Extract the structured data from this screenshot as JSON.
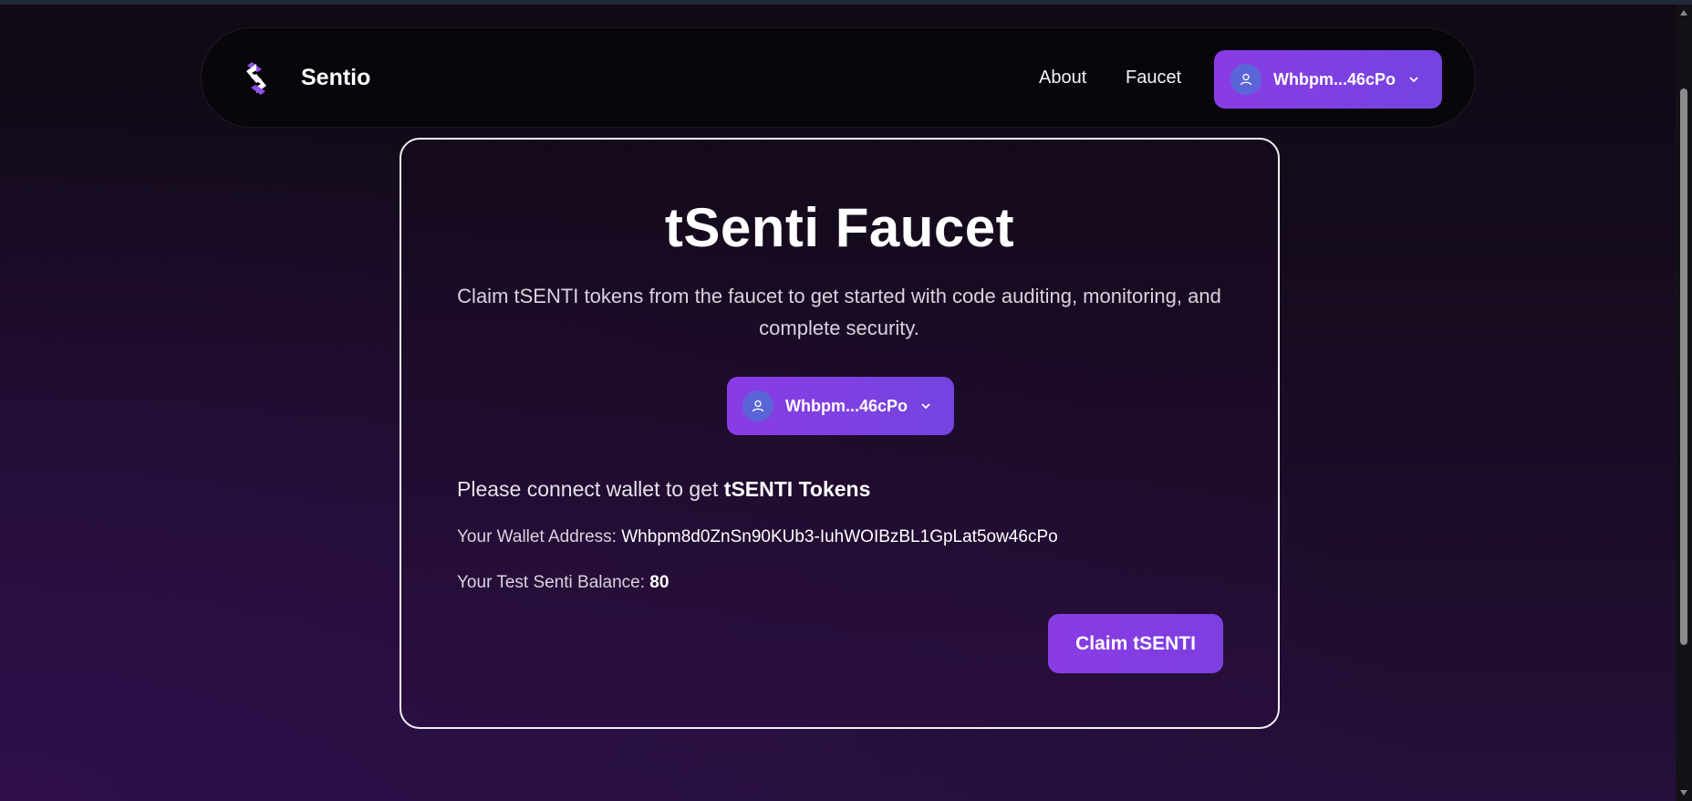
{
  "nav": {
    "brand": "Sentio",
    "links": [
      "About",
      "Faucet"
    ],
    "wallet_label": "Whbpm...46cPo"
  },
  "faucet": {
    "title": "tSenti Faucet",
    "description": "Claim tSENTI tokens from the faucet to get started with code auditing, monitoring, and complete security.",
    "wallet_label": "Whbpm...46cPo",
    "connect_prefix": "Please connect wallet to get ",
    "connect_bold": "tSENTI Tokens",
    "address_label": "Your Wallet Address: ",
    "address_value": "Whbpm8d0ZnSn90KUb3-IuhWOIBzBL1GpLat5ow46cPo",
    "balance_label": "Your Test Senti Balance: ",
    "balance_value": "80",
    "claim_button": "Claim tSENTI"
  },
  "icons": {
    "logo": "sentio-logo",
    "avatar": "user-icon",
    "dropdown": "chevron-down-icon"
  },
  "colors": {
    "accent_start": "#8a3ce4",
    "accent_end": "#7344e0",
    "avatar": "#5a66d8",
    "card_border": "#f2f0f4"
  }
}
